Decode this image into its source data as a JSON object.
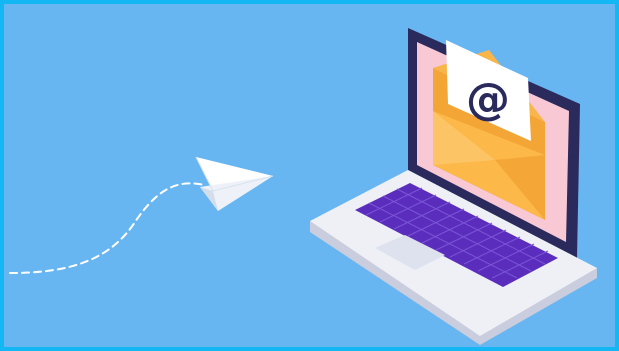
{
  "illustration": {
    "envelope_symbol": "@",
    "icons": [
      "paper-plane-icon",
      "laptop-icon",
      "envelope-icon",
      "at-sign-icon"
    ],
    "colors": {
      "border": "#12b7f3",
      "background": "#67b6f1",
      "laptop_frame": "#2a2a5c",
      "screen": "#f8c8d4",
      "envelope": "#fcb848",
      "keyboard": "#5b2dbd",
      "laptop_body": "#eef0f6",
      "plane": "#ffffff"
    }
  }
}
